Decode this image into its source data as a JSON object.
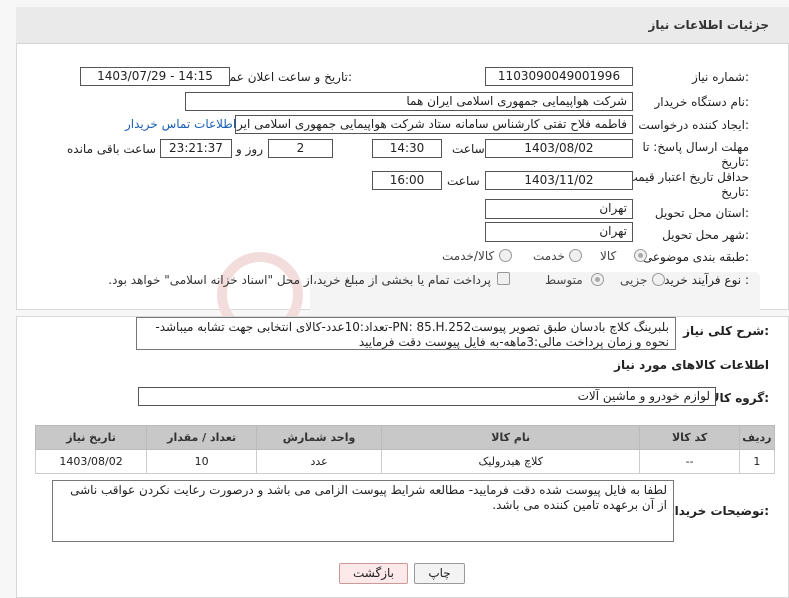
{
  "header": {
    "title": "جزئیات اطلاعات نیاز"
  },
  "fields": {
    "need_number_label": "شماره نیاز:",
    "need_number": "1103090049001996",
    "announce_label": "تاریخ و ساعت اعلان عمومی:",
    "announce_value": "1403/07/29 - 14:15",
    "buyer_org_label": "نام دستگاه خریدار:",
    "buyer_org": "شرکت هواپیمایی جمهوری اسلامی ایران هما",
    "creator_label": "ایجاد کننده درخواست:",
    "creator": "فاطمه فلاح تفتی کارشناس سامانه ستاد شرکت هواپیمایی جمهوری اسلامی ایران هما",
    "contact_link": "اطلاعات تماس خریدار",
    "deadline_label_1": "مهلت ارسال پاسخ: تا",
    "deadline_label_2": "تاریخ:",
    "deadline_date": "1403/08/02",
    "time_label": "ساعت",
    "deadline_time": "14:30",
    "days_value": "2",
    "days_label": "روز و",
    "remaining_time": "23:21:37",
    "remaining_label": "ساعت باقی مانده",
    "validity_label_1": "حداقل تاریخ اعتبار قیمت: تا",
    "validity_label_2": "تاریخ:",
    "validity_date": "1403/11/02",
    "validity_time_label": "ساعت",
    "validity_time": "16:00",
    "province_label": "استان محل تحویل:",
    "province": "تهران",
    "city_label": "شهر محل تحویل:",
    "city": "تهران",
    "category_label": "طبقه بندی موضوعی:",
    "category_options": [
      "کالا",
      "خدمت",
      "کالا/خدمت"
    ],
    "process_label": "نوع فرآیند خرید :",
    "process_options": [
      "جزیی",
      "متوسط"
    ],
    "payment_note": "پرداخت تمام یا بخشی از مبلغ خرید،از محل \"اسناد خزانه اسلامی\" خواهد بود."
  },
  "general_description": {
    "label": "شرح کلی نیاز:",
    "text": "بلبرینگ کلاچ بادسان طبق تصویر پیوستPN: 85.H.252-تعداد:10عدد-کالای انتخابی جهت تشابه میباشد-نحوه و زمان پرداخت مالی:3ماهه-به فایل پیوست دقت فرمایید"
  },
  "goods_info": {
    "heading": "اطلاعات کالاهای مورد نیاز",
    "group_label": "گروه کالا:",
    "group_value": "لوازم خودرو و ماشین آلات"
  },
  "table": {
    "headers": [
      "ردیف",
      "کد کالا",
      "نام کالا",
      "واحد شمارش",
      "تعداد / مقدار",
      "تاریخ نیاز"
    ],
    "rows": [
      [
        "1",
        "--",
        "کلاچ هیدرولیک",
        "عدد",
        "10",
        "1403/08/02"
      ]
    ]
  },
  "buyer_notes": {
    "label": "توضیحات خریدار:",
    "text": "لطفا به فایل پیوست شده دقت فرمایید- مطالعه شرایط پیوست الزامی می باشد و درصورت رعایت نکردن عواقب ناشی از آن برعهده تامین کننده می باشد."
  },
  "buttons": {
    "print": "چاپ",
    "back": "بازگشت"
  },
  "colors": {
    "link": "#1a5fb4",
    "header_bg": "#eaeaea",
    "table_header": "#c8c8c8"
  }
}
